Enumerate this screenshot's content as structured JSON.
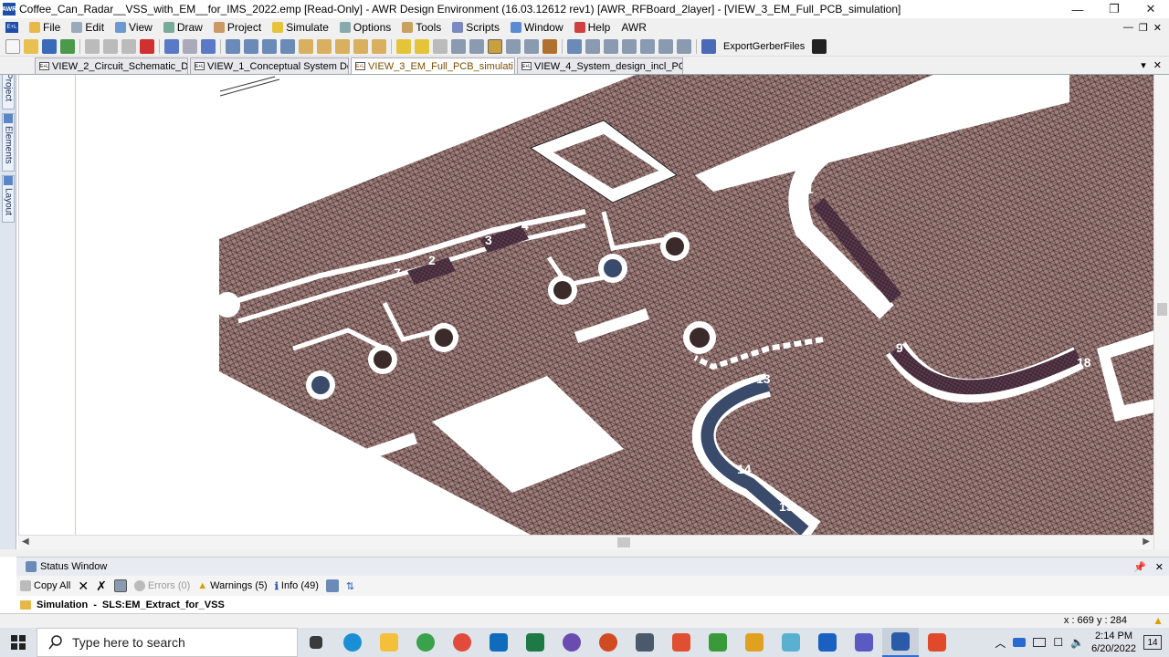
{
  "window": {
    "title": "Coffee_Can_Radar__VSS_with_EM__for_IMS_2022.emp [Read-Only] - AWR Design Environment (16.03.12612 rev1) [AWR_RFBoard_2layer] - [VIEW_3_EM_Full_PCB_simulation]",
    "app_icon": "AWR",
    "minimize": "—",
    "maximize": "❐",
    "close": "✕"
  },
  "menu": {
    "items": [
      "File",
      "Edit",
      "View",
      "Draw",
      "Project",
      "Simulate",
      "Options",
      "Tools",
      "Scripts",
      "Window",
      "Help",
      "AWR"
    ],
    "mdi_controls": [
      "—",
      "❐",
      "✕"
    ]
  },
  "toolbar": {
    "export_label": "ExportGerberFiles"
  },
  "tabs": [
    {
      "label": "VIEW_2_Circuit_Schematic_Design",
      "active": false
    },
    {
      "label": "VIEW_1_Conceptual System Design",
      "active": false
    },
    {
      "label": "VIEW_3_EM_Full_PCB_simulati...",
      "active": true
    },
    {
      "label": "VIEW_4_System_design_incl_PCB_E...",
      "active": false
    }
  ],
  "tab_controls": {
    "dropdown": "▾",
    "close": "✕"
  },
  "sidebar": {
    "tabs": [
      "Project",
      "Elements",
      "Layout"
    ]
  },
  "layout_labels": [
    "1",
    "2",
    "3",
    "4",
    "7",
    "8",
    "9",
    "13",
    "14",
    "15",
    "18"
  ],
  "status_window": {
    "title": "Status Window",
    "pin": "📌",
    "close": "✕",
    "copy_all": "Copy All",
    "errors": "Errors (0)",
    "warnings": "Warnings (5)",
    "info": "Info (49)",
    "row_category": "Simulation",
    "row_detail": "SLS:EM_Extract_for_VSS"
  },
  "statusbar": {
    "coords": "x : 669   y : 284"
  },
  "taskbar": {
    "search_placeholder": "Type here to search",
    "apps": [
      {
        "name": "task-view",
        "color": "#3a3a3a"
      },
      {
        "name": "edge",
        "color": "#1b8fd6"
      },
      {
        "name": "file-explorer",
        "color": "#f4c03c"
      },
      {
        "name": "maps",
        "color": "#3aa24a"
      },
      {
        "name": "chrome",
        "color": "#e04b3c"
      },
      {
        "name": "outlook",
        "color": "#0f6cbd"
      },
      {
        "name": "excel",
        "color": "#1d7a45"
      },
      {
        "name": "settings-app",
        "color": "#6a4bb0"
      },
      {
        "name": "powerpoint",
        "color": "#d04a22"
      },
      {
        "name": "calculator",
        "color": "#4a5a6a"
      },
      {
        "name": "snagit",
        "color": "#e05030"
      },
      {
        "name": "editor",
        "color": "#3a9a3a"
      },
      {
        "name": "media",
        "color": "#e0a020"
      },
      {
        "name": "notes",
        "color": "#5ab0d0"
      },
      {
        "name": "mail",
        "color": "#1a60c0"
      },
      {
        "name": "teams",
        "color": "#5a5ac0"
      },
      {
        "name": "awr",
        "color": "#2a5aa8",
        "active": true
      },
      {
        "name": "camtasia",
        "color": "#e04a2a"
      }
    ],
    "time": "2:14 PM",
    "date": "6/20/2022",
    "notifications": "14"
  }
}
